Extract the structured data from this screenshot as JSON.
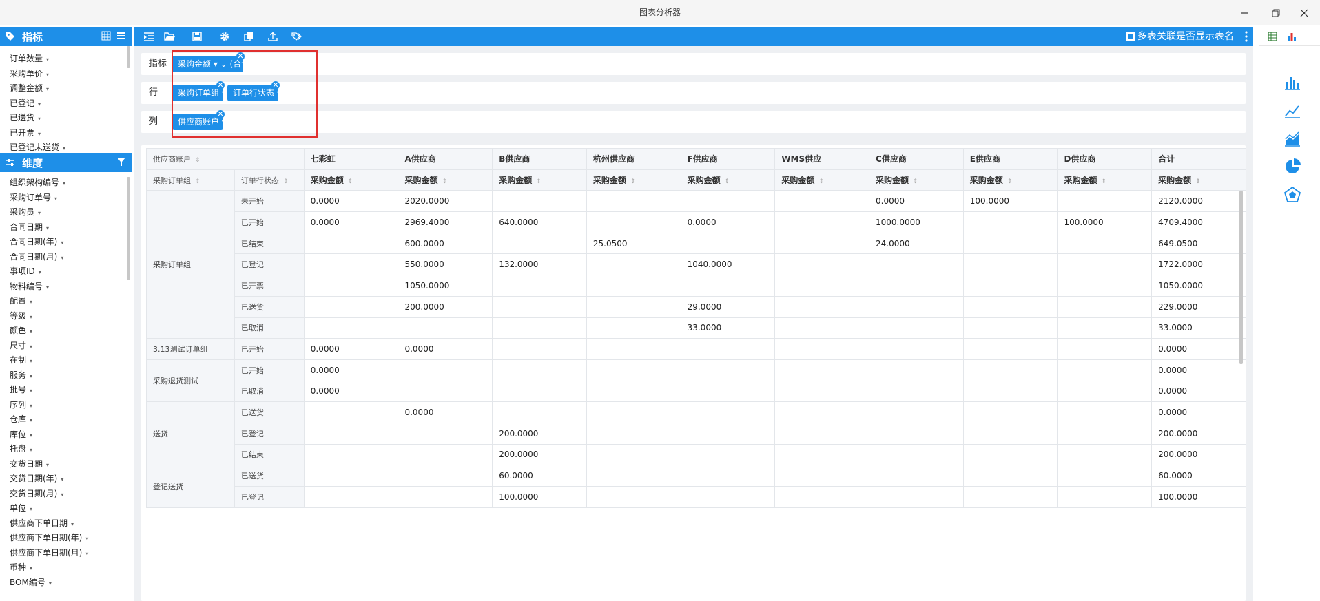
{
  "window": {
    "title": "图表分析器"
  },
  "left_panel": {
    "metrics": {
      "title": "指标",
      "items": [
        "订单数量",
        "采购单价",
        "调整金额",
        "已登记",
        "已送货",
        "已开票",
        "已登记未送货"
      ]
    },
    "dimensions": {
      "title": "维度",
      "items": [
        "组织架构编号",
        "采购订单号",
        "采购员",
        "合同日期",
        "合同日期(年)",
        "合同日期(月)",
        "事项ID",
        "物料编号",
        "配置",
        "等级",
        "颜色",
        "尺寸",
        "在制",
        "服务",
        "批号",
        "序列",
        "仓库",
        "库位",
        "托盘",
        "交货日期",
        "交货日期(年)",
        "交货日期(月)",
        "单位",
        "供应商下单日期",
        "供应商下单日期(年)",
        "供应商下单日期(月)",
        "币种",
        "BOM编号"
      ]
    }
  },
  "toolbar": {
    "icons": [
      "indent-icon",
      "folder-open-icon",
      "save-icon",
      "gear-icon",
      "copy-icon",
      "upload-icon",
      "tags-icon"
    ],
    "show_table_name_label": "多表关联是否显示表名"
  },
  "zones": {
    "metric": {
      "label": "指标",
      "pills": [
        {
          "text": "采购金额 ▾ ⌄ (合计)"
        }
      ]
    },
    "row": {
      "label": "行",
      "pills": [
        {
          "text": "采购订单组 ▾"
        },
        {
          "text": "订单行状态 ▾"
        }
      ]
    },
    "column": {
      "label": "列",
      "pills": [
        {
          "text": "供应商账户 ▾"
        }
      ]
    }
  },
  "table": {
    "col_dim_label": "供应商账户",
    "row_dim_labels": [
      "采购订单组",
      "订单行状态"
    ],
    "suppliers": [
      "七彩虹",
      "A供应商",
      "B供应商",
      "杭州供应商",
      "F供应商",
      "WMS供应",
      "C供应商",
      "E供应商",
      "D供应商",
      "合计"
    ],
    "measure": "采购金额",
    "groups": [
      {
        "name": "采购订单组",
        "rows": [
          {
            "status": "未开始",
            "values": [
              "0.0000",
              "2020.0000",
              "",
              "",
              "",
              "",
              "0.0000",
              "100.0000",
              "",
              "2120.0000"
            ]
          },
          {
            "status": "已开始",
            "values": [
              "0.0000",
              "2969.4000",
              "640.0000",
              "",
              "0.0000",
              "",
              "1000.0000",
              "",
              "100.0000",
              "4709.4000"
            ]
          },
          {
            "status": "已结束",
            "values": [
              "",
              "600.0000",
              "",
              "25.0500",
              "",
              "",
              "24.0000",
              "",
              "",
              "649.0500"
            ]
          },
          {
            "status": "已登记",
            "values": [
              "",
              "550.0000",
              "132.0000",
              "",
              "1040.0000",
              "",
              "",
              "",
              "",
              "1722.0000"
            ]
          },
          {
            "status": "已开票",
            "values": [
              "",
              "1050.0000",
              "",
              "",
              "",
              "",
              "",
              "",
              "",
              "1050.0000"
            ]
          },
          {
            "status": "已送货",
            "values": [
              "",
              "200.0000",
              "",
              "",
              "29.0000",
              "",
              "",
              "",
              "",
              "229.0000"
            ]
          },
          {
            "status": "已取消",
            "values": [
              "",
              "",
              "",
              "",
              "33.0000",
              "",
              "",
              "",
              "",
              "33.0000"
            ]
          }
        ]
      },
      {
        "name": "3.13测试订单组",
        "rows": [
          {
            "status": "已开始",
            "values": [
              "0.0000",
              "0.0000",
              "",
              "",
              "",
              "",
              "",
              "",
              "",
              "0.0000"
            ]
          }
        ]
      },
      {
        "name": "采购退货测试",
        "rows": [
          {
            "status": "已开始",
            "values": [
              "0.0000",
              "",
              "",
              "",
              "",
              "",
              "",
              "",
              "",
              "0.0000"
            ]
          },
          {
            "status": "已取消",
            "values": [
              "0.0000",
              "",
              "",
              "",
              "",
              "",
              "",
              "",
              "",
              "0.0000"
            ]
          }
        ]
      },
      {
        "name": "送货",
        "rows": [
          {
            "status": "已送货",
            "values": [
              "",
              "0.0000",
              "",
              "",
              "",
              "",
              "",
              "",
              "",
              "0.0000"
            ]
          },
          {
            "status": "已登记",
            "values": [
              "",
              "",
              "200.0000",
              "",
              "",
              "",
              "",
              "",
              "",
              "200.0000"
            ]
          },
          {
            "status": "已结束",
            "values": [
              "",
              "",
              "200.0000",
              "",
              "",
              "",
              "",
              "",
              "",
              "200.0000"
            ]
          }
        ]
      },
      {
        "name": "登记送货",
        "rows": [
          {
            "status": "已送货",
            "values": [
              "",
              "",
              "60.0000",
              "",
              "",
              "",
              "",
              "",
              "",
              "60.0000"
            ]
          },
          {
            "status": "已登记",
            "values": [
              "",
              "",
              "100.0000",
              "",
              "",
              "",
              "",
              "",
              "",
              "100.0000"
            ]
          }
        ]
      }
    ]
  },
  "right_panel": {
    "tabs": [
      "table-tab-icon",
      "chart-tab-icon"
    ],
    "chart_types": [
      "bar-chart-icon",
      "line-chart-icon",
      "area-chart-icon",
      "pie-chart-icon",
      "radar-chart-icon"
    ]
  }
}
